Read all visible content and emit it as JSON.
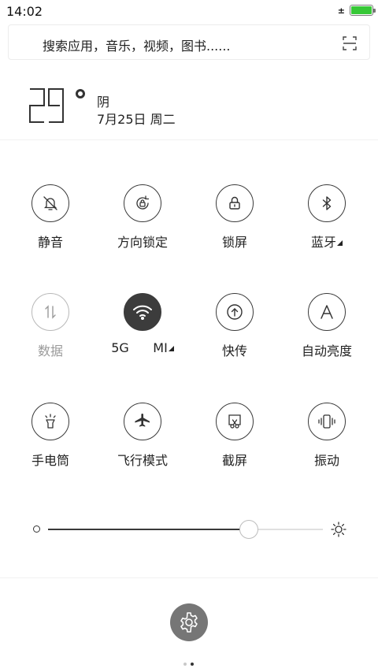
{
  "status_bar": {
    "time": "14:02",
    "signal_glyph": "±",
    "battery_level": 1.0
  },
  "search": {
    "placeholder": "搜索应用，音乐，视频，图书......",
    "scan_icon": "scan-icon"
  },
  "weather": {
    "temperature": "29°",
    "condition": "阴",
    "date": "7月25日 周二"
  },
  "tiles": [
    {
      "label": "静音",
      "icon": "bell-mute-icon",
      "state": "normal"
    },
    {
      "label": "方向锁定",
      "icon": "rotation-lock-icon",
      "state": "normal"
    },
    {
      "label": "锁屏",
      "icon": "lock-icon",
      "state": "normal"
    },
    {
      "label": "蓝牙",
      "icon": "bluetooth-icon",
      "state": "normal",
      "expand": true
    },
    {
      "label": "数据",
      "icon": "mobile-data-icon",
      "state": "disabled"
    },
    {
      "label": "5G      MI",
      "icon": "wifi-icon",
      "state": "on",
      "expand": true
    },
    {
      "label": "快传",
      "icon": "quick-share-icon",
      "state": "normal"
    },
    {
      "label": "自动亮度",
      "icon": "auto-brightness-icon",
      "state": "normal"
    },
    {
      "label": "手电筒",
      "icon": "flashlight-icon",
      "state": "normal"
    },
    {
      "label": "飞行模式",
      "icon": "airplane-icon",
      "state": "normal"
    },
    {
      "label": "截屏",
      "icon": "screenshot-icon",
      "state": "normal"
    },
    {
      "label": "振动",
      "icon": "vibrate-icon",
      "state": "normal"
    }
  ],
  "brightness": {
    "level": 0.73
  },
  "pager": {
    "pages": 2,
    "current": 2
  },
  "colors": {
    "panel_bg": "#ffffff",
    "tile_on": "#3c3c3c",
    "battery": "#37c837",
    "settings_bg": "#767676"
  }
}
